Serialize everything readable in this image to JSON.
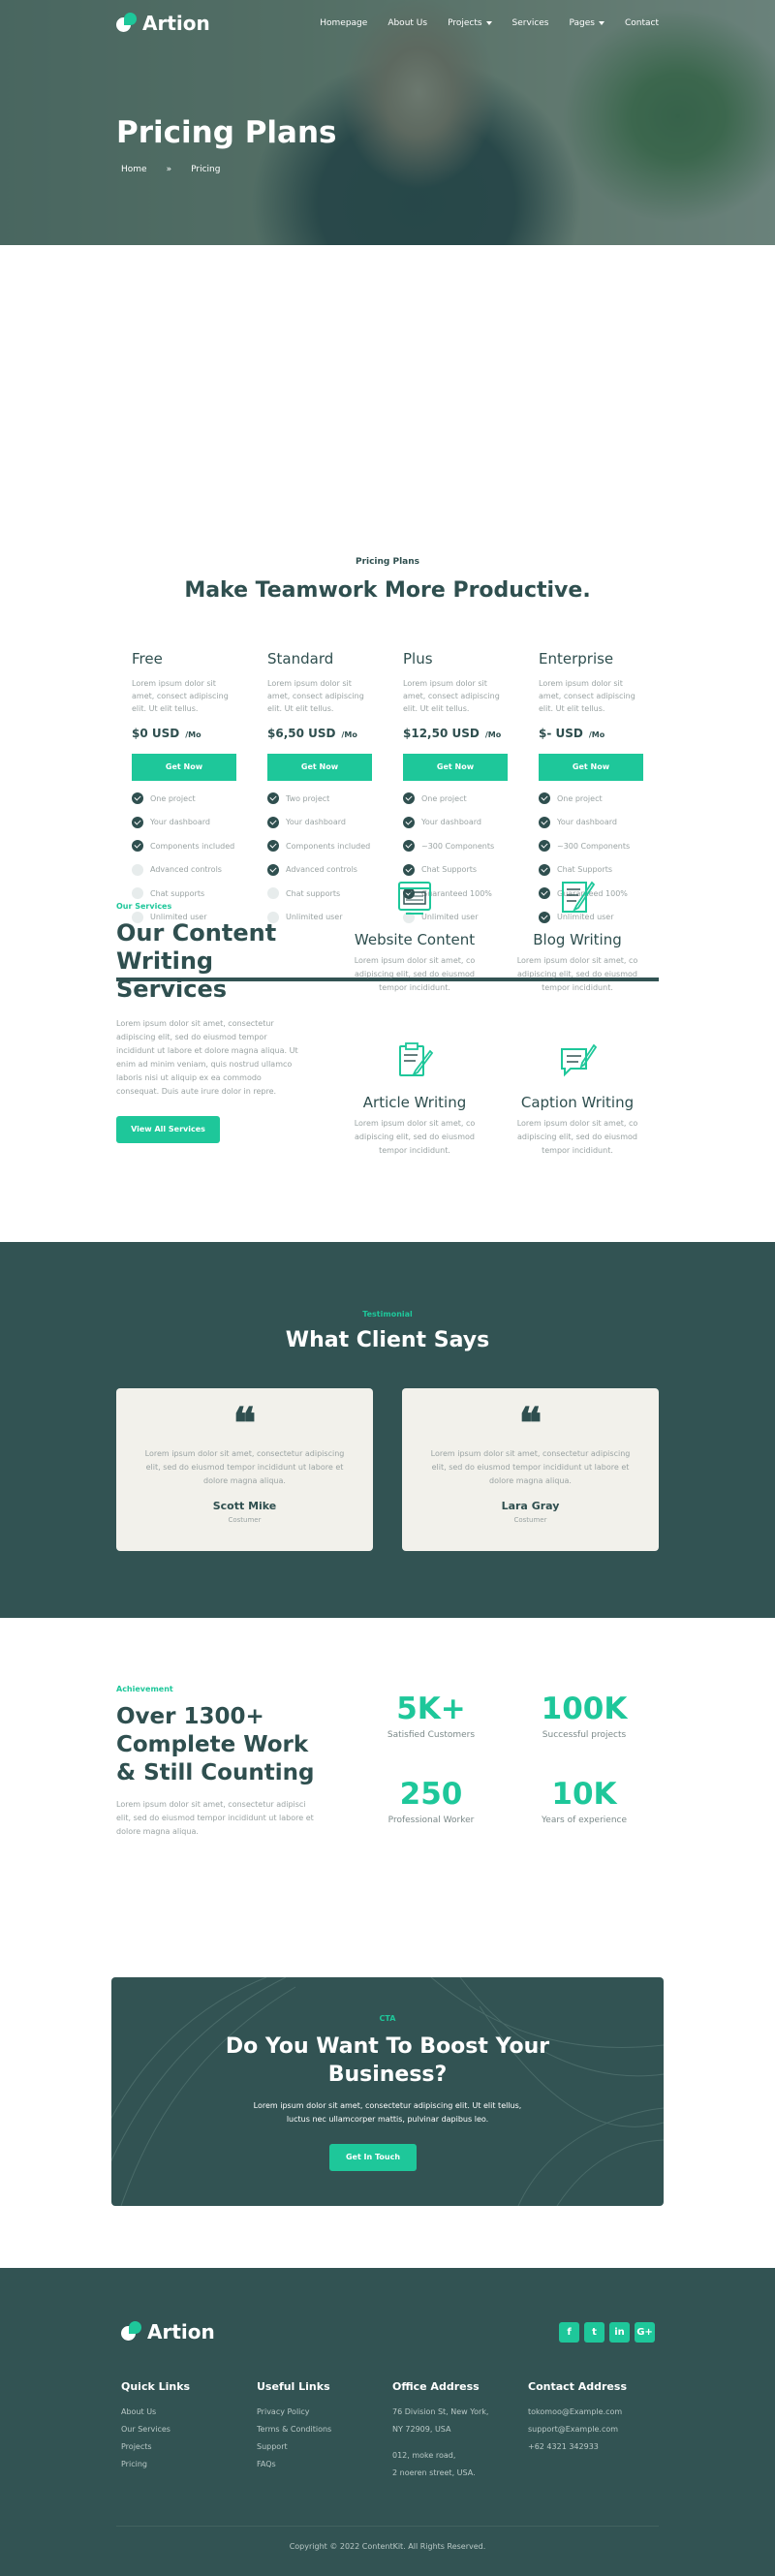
{
  "nav": {
    "brand": "Artion",
    "items": [
      "Homepage",
      "About Us",
      "Projects",
      "Services",
      "Pages",
      "Contact"
    ]
  },
  "hero": {
    "title": "Pricing Plans",
    "breadcrumb": [
      "Home",
      "Pricing"
    ],
    "separator": "»"
  },
  "pricing": {
    "eyebrow": "Pricing Plans",
    "title": "Make Teamwork More Productive.",
    "plans": [
      {
        "name": "Free",
        "desc": "Lorem ipsum dolor sit amet, consect adipiscing elit. Ut elit tellus.",
        "price": "$0 USD",
        "per": "/Mo",
        "cta": "Get Now",
        "features": [
          {
            "t": "One project",
            "on": true
          },
          {
            "t": "Your dashboard",
            "on": true
          },
          {
            "t": "Components included",
            "on": true
          },
          {
            "t": "Advanced controls",
            "on": false
          },
          {
            "t": "Chat supports",
            "on": false
          },
          {
            "t": "Unlimited user",
            "on": false
          }
        ]
      },
      {
        "name": "Standard",
        "desc": "Lorem ipsum dolor sit amet, consect adipiscing elit. Ut elit tellus.",
        "price": "$6,50 USD",
        "per": "/Mo",
        "cta": "Get Now",
        "features": [
          {
            "t": "Two project",
            "on": true
          },
          {
            "t": "Your dashboard",
            "on": true
          },
          {
            "t": "Components included",
            "on": true
          },
          {
            "t": "Advanced controls",
            "on": true
          },
          {
            "t": "Chat supports",
            "on": false
          },
          {
            "t": "Unlimited user",
            "on": false
          }
        ]
      },
      {
        "name": "Plus",
        "desc": "Lorem ipsum dolor sit amet, consect adipiscing elit. Ut elit tellus.",
        "price": "$12,50 USD",
        "per": "/Mo",
        "cta": "Get Now",
        "features": [
          {
            "t": "One project",
            "on": true
          },
          {
            "t": "Your dashboard",
            "on": true
          },
          {
            "t": "~300 Components",
            "on": true
          },
          {
            "t": "Chat Supports",
            "on": true
          },
          {
            "t": "Guaranteed 100%",
            "on": true
          },
          {
            "t": "Unlimited user",
            "on": false
          }
        ]
      },
      {
        "name": "Enterprise",
        "desc": "Lorem ipsum dolor sit amet, consect adipiscing elit. Ut elit tellus.",
        "price": "$- USD",
        "per": "/Mo",
        "cta": "Get Now",
        "features": [
          {
            "t": "One project",
            "on": true
          },
          {
            "t": "Your dashboard",
            "on": true
          },
          {
            "t": "~300 Components",
            "on": true
          },
          {
            "t": "Chat Supports",
            "on": true
          },
          {
            "t": "Guaranteed 100%",
            "on": true
          },
          {
            "t": "Unlimited user",
            "on": true
          }
        ]
      }
    ]
  },
  "services": {
    "eyebrow": "Our Services",
    "title": "Our Content Writing Services",
    "text": "Lorem ipsum dolor sit amet, consectetur adipiscing elit, sed do eiusmod tempor incididunt ut labore et dolore magna aliqua. Ut enim ad minim veniam, quis nostrud ullamco laboris nisi ut aliquip ex ea commodo consequat. Duis aute irure dolor in repre.",
    "button": "View All Services",
    "items": [
      {
        "title": "Website Content",
        "icon": "browser-icon",
        "desc": "Lorem ipsum dolor sit amet, co adipiscing elit, sed do eiusmod tempor incididunt."
      },
      {
        "title": "Blog Writing",
        "icon": "blog-edit-icon",
        "desc": "Lorem ipsum dolor sit amet, co adipiscing elit, sed do eiusmod tempor incididunt."
      },
      {
        "title": "Article Writing",
        "icon": "article-edit-icon",
        "desc": "Lorem ipsum dolor sit amet, co adipiscing elit, sed do eiusmod tempor incididunt."
      },
      {
        "title": "Caption Writing",
        "icon": "caption-icon",
        "desc": "Lorem ipsum dolor sit amet, co adipiscing elit, sed do eiusmod tempor incididunt."
      }
    ]
  },
  "testimonials": {
    "eyebrow": "Testimonial",
    "title": "What Client Says",
    "quote_mark": "❝",
    "items": [
      {
        "text": "Lorem ipsum dolor sit amet, consectetur adipiscing elit, sed do eiusmod tempor incididunt ut labore et dolore magna aliqua.",
        "name": "Scott Mike",
        "role": "Costumer"
      },
      {
        "text": "Lorem ipsum dolor sit amet, consectetur adipiscing elit, sed do eiusmod tempor incididunt ut labore et dolore magna aliqua.",
        "name": "Lara Gray",
        "role": "Costumer"
      }
    ]
  },
  "achievement": {
    "eyebrow": "Achievement",
    "title": "Over 1300+ Complete Work & Still Counting",
    "text": "Lorem ipsum dolor sit amet, consectetur adipisci elit, sed do eiusmod tempor incididunt ut labore et dolore magna aliqua.",
    "stats": [
      {
        "num": "5K+",
        "label": "Satisfied Customers"
      },
      {
        "num": "100K",
        "label": "Successful projects"
      },
      {
        "num": "250",
        "label": "Professional Worker"
      },
      {
        "num": "10K",
        "label": "Years of experience"
      }
    ]
  },
  "cta": {
    "eyebrow": "CTA",
    "title": "Do You Want To Boost Your Business?",
    "text": "Lorem ipsum dolor sit amet, consectetur adipiscing elit. Ut elit tellus, luctus nec ullamcorper mattis, pulvinar dapibus leo.",
    "button": "Get In Touch"
  },
  "footer": {
    "brand": "Artion",
    "social": [
      "f",
      "t",
      "in",
      "G+"
    ],
    "columns": [
      {
        "title": "Quick Links",
        "items": [
          "About Us",
          "Our Services",
          "Projects",
          "Pricing"
        ]
      },
      {
        "title": "Useful Links",
        "items": [
          "Privacy Policy",
          "Terms & Conditions",
          "Support",
          "FAQs"
        ]
      },
      {
        "title": "Office Address",
        "items": [
          "76 Division St, New York,",
          "NY 72909, USA",
          "",
          "012, moke road,",
          "2 noeren street, USA."
        ]
      },
      {
        "title": "Contact Address",
        "items": [
          "tokomoo@Example.com",
          "support@Example.com",
          "+62 4321 342933"
        ]
      }
    ],
    "copyright": "Copyright © 2022 ContentKit. All Rights Reserved."
  },
  "colors": {
    "accent": "#1ec79a",
    "dark": "#325353",
    "card": "#f2f1eb"
  }
}
